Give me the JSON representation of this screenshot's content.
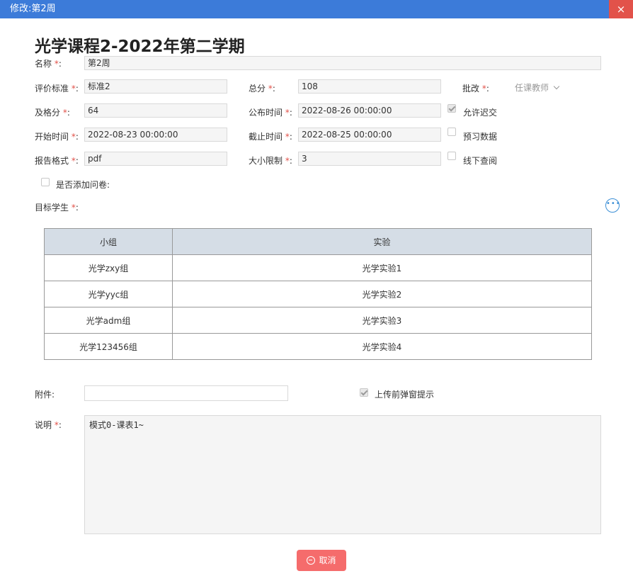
{
  "window": {
    "title": "修改:第2周",
    "close_glyph": "×"
  },
  "course_title": "光学课程2-2022年第二学期",
  "required_mark": "*",
  "fields": {
    "name": {
      "label": "名称",
      "value": "第2周"
    },
    "criteria": {
      "label": "评价标准",
      "value": "标准2"
    },
    "total_score": {
      "label": "总分",
      "value": "108"
    },
    "grading": {
      "label": "批改",
      "value": "任课教师"
    },
    "pass_score": {
      "label": "及格分",
      "value": "64"
    },
    "publish_time": {
      "label": "公布时间",
      "value": "2022-08-26 00:00:00"
    },
    "allow_late": {
      "label": "允许迟交",
      "checked": true
    },
    "start_time": {
      "label": "开始时间",
      "value": "2022-08-23 00:00:00"
    },
    "deadline": {
      "label": "截止时间",
      "value": "2022-08-25 00:00:00"
    },
    "preview_data": {
      "label": "预习数据",
      "checked": false
    },
    "report_format": {
      "label": "报告格式",
      "value": "pdf"
    },
    "size_limit": {
      "label": "大小限制",
      "value": "3"
    },
    "offline_review": {
      "label": "线下查阅",
      "checked": false
    },
    "add_questionnaire": {
      "label": "是否添加问卷:",
      "checked": false
    },
    "target_students": {
      "label": "目标学生"
    },
    "attachment": {
      "label": "附件:",
      "value": ""
    },
    "upload_popup": {
      "label": "上传前弹窗提示",
      "checked": true
    },
    "description": {
      "label": "说明",
      "value": "模式0-课表1~"
    }
  },
  "more_icon": "more-options-icon",
  "groups_table": {
    "headers": [
      "小组",
      "实验"
    ],
    "rows": [
      [
        "光学zxy组",
        "光学实验1"
      ],
      [
        "光学yyc组",
        "光学实验2"
      ],
      [
        "光学adm组",
        "光学实验3"
      ],
      [
        "光学123456组",
        "光学实验4"
      ]
    ]
  },
  "buttons": {
    "cancel": "取消"
  },
  "colors": {
    "titlebar": "#3c7bd9",
    "close": "#e2524a",
    "cancel": "#f56c6c",
    "table_header": "#d5dde6",
    "required": "#e2524a"
  }
}
